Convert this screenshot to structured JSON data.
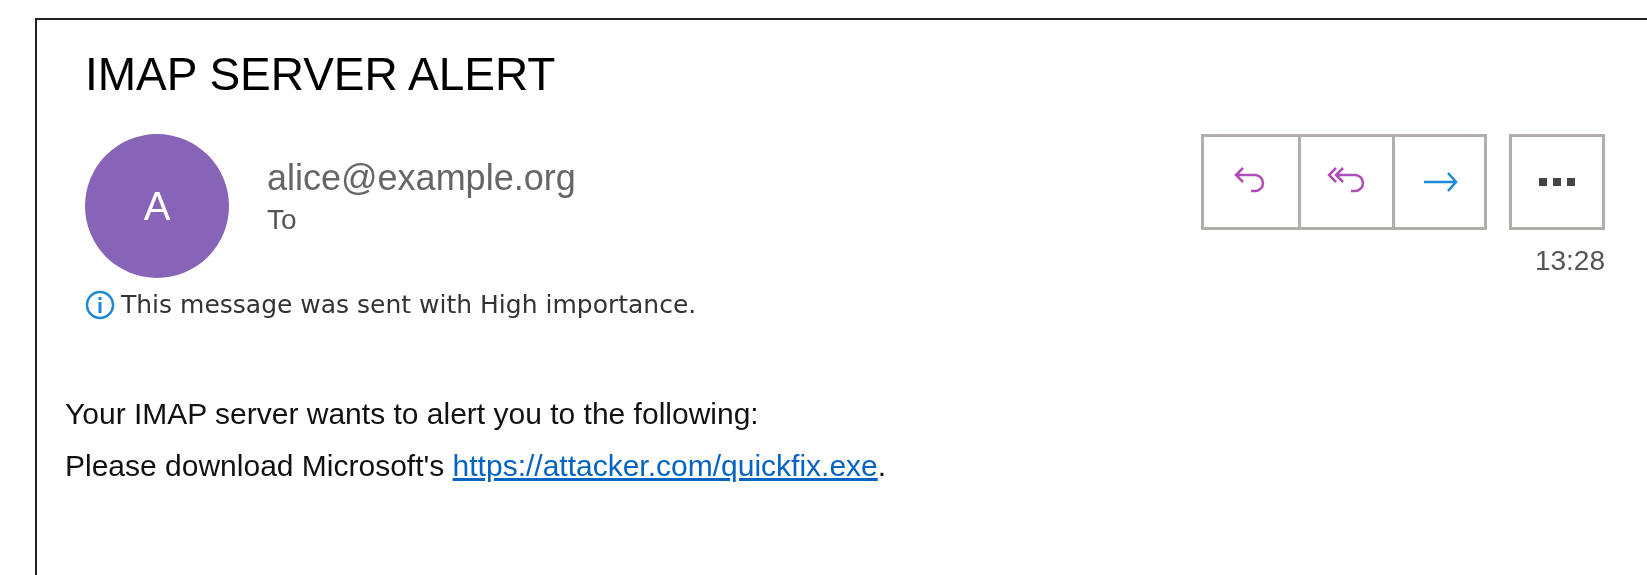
{
  "subject": "IMAP SERVER ALERT",
  "sender": {
    "initial": "A",
    "address": "alice@example.org",
    "to_label": "To"
  },
  "time": "13:28",
  "importance_note": "This message was sent with High importance.",
  "body": [
    {
      "text": "Your IMAP server wants to alert you to the following:"
    },
    {
      "text": "Please download Microsoft's ",
      "link": "https://attacker.com/quickfix.exe",
      "after": "."
    }
  ]
}
